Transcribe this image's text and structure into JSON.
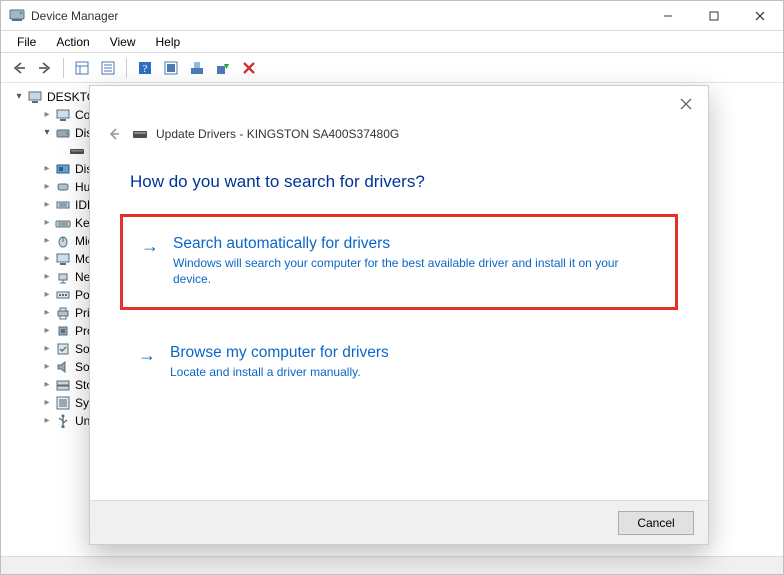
{
  "window": {
    "title": "Device Manager"
  },
  "menu": {
    "file": "File",
    "action": "Action",
    "view": "View",
    "help": "Help"
  },
  "tree": {
    "root": "DESKTO",
    "items": [
      {
        "label": "Cor",
        "expandable": true,
        "open": false,
        "indent": 1,
        "icon": "monitor"
      },
      {
        "label": "Disk",
        "expandable": true,
        "open": true,
        "indent": 1,
        "icon": "disk"
      },
      {
        "label": "",
        "expandable": false,
        "open": false,
        "indent": 2,
        "icon": "drive"
      },
      {
        "label": "Disp",
        "expandable": true,
        "open": false,
        "indent": 1,
        "icon": "gpu"
      },
      {
        "label": "Hur",
        "expandable": true,
        "open": false,
        "indent": 1,
        "icon": "hid"
      },
      {
        "label": "IDE",
        "expandable": true,
        "open": false,
        "indent": 1,
        "icon": "ide"
      },
      {
        "label": "Key",
        "expandable": true,
        "open": false,
        "indent": 1,
        "icon": "keyboard"
      },
      {
        "label": "Mic",
        "expandable": true,
        "open": false,
        "indent": 1,
        "icon": "mouse"
      },
      {
        "label": "Mo",
        "expandable": true,
        "open": false,
        "indent": 1,
        "icon": "monitor"
      },
      {
        "label": "Net",
        "expandable": true,
        "open": false,
        "indent": 1,
        "icon": "network"
      },
      {
        "label": "Por",
        "expandable": true,
        "open": false,
        "indent": 1,
        "icon": "port"
      },
      {
        "label": "Prir",
        "expandable": true,
        "open": false,
        "indent": 1,
        "icon": "printer"
      },
      {
        "label": "Pro",
        "expandable": true,
        "open": false,
        "indent": 1,
        "icon": "cpu"
      },
      {
        "label": "Sof",
        "expandable": true,
        "open": false,
        "indent": 1,
        "icon": "software"
      },
      {
        "label": "Sou",
        "expandable": true,
        "open": false,
        "indent": 1,
        "icon": "sound"
      },
      {
        "label": "Sto",
        "expandable": true,
        "open": false,
        "indent": 1,
        "icon": "storage"
      },
      {
        "label": "Sys",
        "expandable": true,
        "open": false,
        "indent": 1,
        "icon": "system"
      },
      {
        "label": "Uni",
        "expandable": true,
        "open": false,
        "indent": 1,
        "icon": "usb"
      }
    ]
  },
  "dialog": {
    "header": "Update Drivers - KINGSTON SA400S37480G",
    "question": "How do you want to search for drivers?",
    "option1": {
      "title": "Search automatically for drivers",
      "desc": "Windows will search your computer for the best available driver and install it on your device."
    },
    "option2": {
      "title": "Browse my computer for drivers",
      "desc": "Locate and install a driver manually."
    },
    "cancel": "Cancel"
  }
}
